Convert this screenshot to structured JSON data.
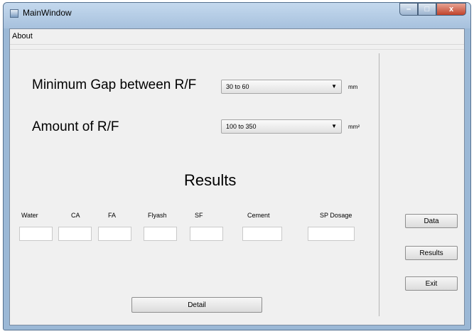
{
  "window": {
    "title": "MainWindow",
    "minimize": "–",
    "maximize": "□",
    "close": "x"
  },
  "menu": {
    "about": "About"
  },
  "form": {
    "gap_label": "Minimum Gap between R/F",
    "gap_value": "30 to 60",
    "gap_unit": "mm",
    "amount_label": "Amount of R/F",
    "amount_value": "100 to 350",
    "amount_unit": "mm²",
    "dropdown_arrow": "▼"
  },
  "results": {
    "title": "Results",
    "columns": [
      "Water",
      "CA",
      "FA",
      "Flyash",
      "SF",
      "Cement",
      "SP Dosage"
    ],
    "values": [
      "",
      "",
      "",
      "",
      "",
      "",
      ""
    ]
  },
  "buttons": {
    "detail": "Detail",
    "data": "Data",
    "results": "Results",
    "exit": "Exit"
  }
}
